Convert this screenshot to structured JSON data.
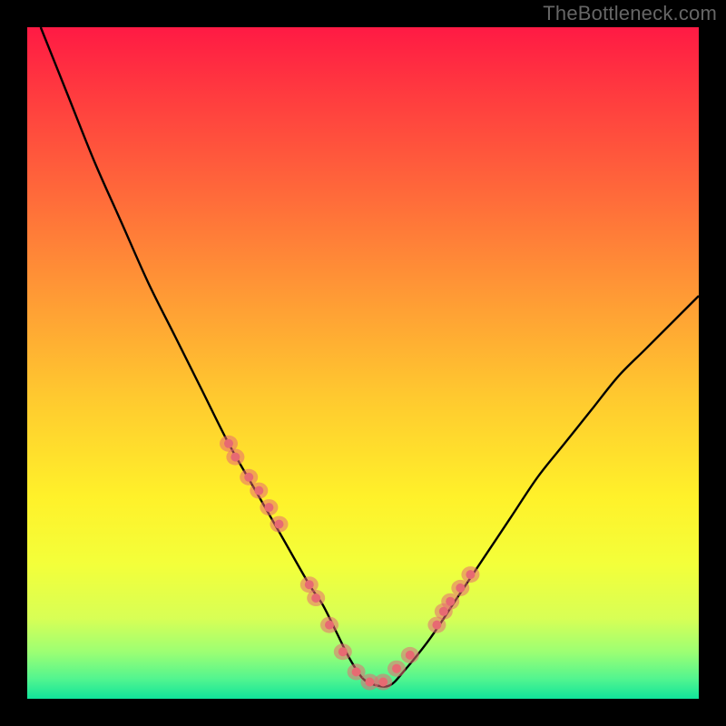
{
  "watermark": "TheBottleneck.com",
  "chart_data": {
    "type": "line",
    "title": "",
    "xlabel": "",
    "ylabel": "",
    "xlim": [
      0,
      100
    ],
    "ylim": [
      0,
      100
    ],
    "series": [
      {
        "name": "bottleneck-curve",
        "x": [
          2,
          6,
          10,
          14,
          18,
          22,
          26,
          30,
          34,
          38,
          42,
          44,
          46,
          48,
          50,
          52,
          54,
          56,
          60,
          64,
          68,
          72,
          76,
          80,
          84,
          88,
          92,
          96,
          100
        ],
        "y": [
          100,
          90,
          80,
          71,
          62,
          54,
          46,
          38,
          31,
          24,
          17,
          14,
          10,
          6,
          3,
          2,
          2,
          4,
          9,
          15,
          21,
          27,
          33,
          38,
          43,
          48,
          52,
          56,
          60
        ]
      }
    ],
    "markers": {
      "name": "highlighted-points",
      "color": "#e76a72",
      "x": [
        30,
        31,
        33,
        34.5,
        36,
        37.5,
        42,
        43,
        45,
        47,
        49,
        51,
        53,
        55,
        57,
        61,
        62,
        63,
        64.5,
        66
      ],
      "y": [
        38,
        36,
        33,
        31,
        28.5,
        26,
        17,
        15,
        11,
        7,
        4,
        2.5,
        2.5,
        4.5,
        6.5,
        11,
        13,
        14.5,
        16.5,
        18.5
      ]
    }
  }
}
